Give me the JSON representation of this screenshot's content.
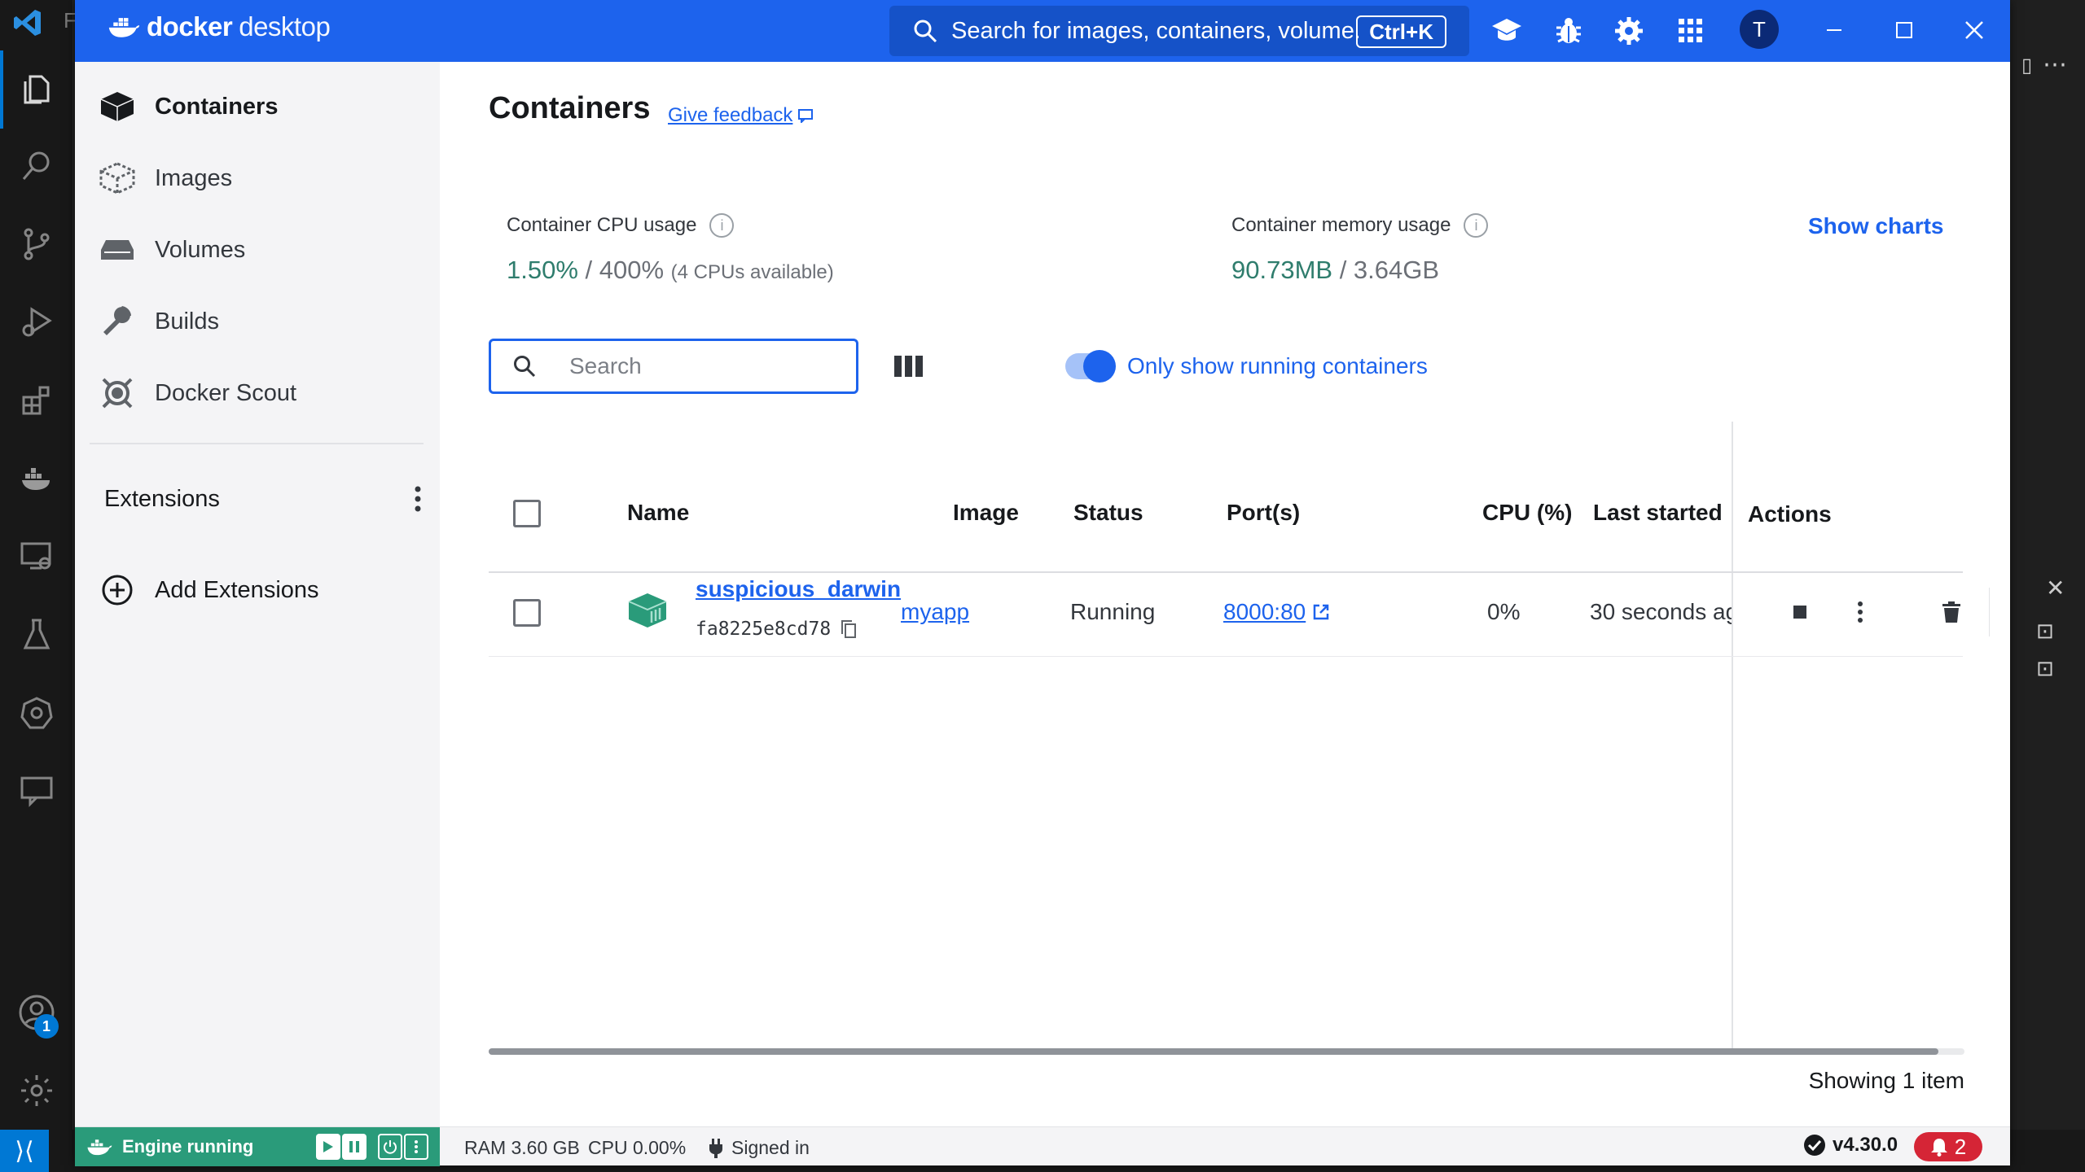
{
  "vscode": {
    "file_letter": "F",
    "accounts_badge": "1"
  },
  "app": {
    "brand_strong": "docker",
    "brand_light": "desktop"
  },
  "global_search": {
    "placeholder": "Search for images, containers, volume...",
    "shortcut": "Ctrl+K"
  },
  "user": {
    "initial": "T"
  },
  "sidebar": {
    "items": [
      {
        "label": "Containers",
        "icon": "containers-icon",
        "active": true
      },
      {
        "label": "Images",
        "icon": "images-icon"
      },
      {
        "label": "Volumes",
        "icon": "volumes-icon"
      },
      {
        "label": "Builds",
        "icon": "builds-wrench-icon"
      },
      {
        "label": "Docker Scout",
        "icon": "docker-scout-icon"
      }
    ],
    "extensions_label": "Extensions",
    "add_extensions_label": "Add Extensions"
  },
  "main": {
    "title": "Containers",
    "feedback_link": "Give feedback",
    "cpu": {
      "label": "Container CPU usage",
      "used": "1.50%",
      "total": "/ 400%",
      "available": "(4 CPUs available)"
    },
    "memory": {
      "label": "Container memory usage",
      "used": "90.73MB",
      "total": "/ 3.64GB"
    },
    "show_charts": "Show charts",
    "search_placeholder": "Search",
    "running_only_label": "Only show running containers",
    "running_only_enabled": true
  },
  "table": {
    "columns": [
      "Name",
      "Image",
      "Status",
      "Port(s)",
      "CPU (%)",
      "Last started",
      "Actions"
    ],
    "rows": [
      {
        "name": "suspicious_darwin",
        "id": "fa8225e8cd78",
        "image": "myapp",
        "status": "Running",
        "ports": "8000:80",
        "cpu": "0%",
        "last_started": "30 seconds ag"
      }
    ],
    "showing": "Showing 1 item"
  },
  "footer": {
    "engine": "Engine running",
    "ram": "RAM 3.60 GB",
    "cpu": "CPU 0.00%",
    "signed_in": "Signed in",
    "version": "v4.30.0",
    "notifications": "2"
  },
  "colors": {
    "brand_blue": "#1d63ed",
    "engine_green": "#2a9b7a",
    "stat_green": "#2f7d6d",
    "alert_red": "#d52536"
  }
}
